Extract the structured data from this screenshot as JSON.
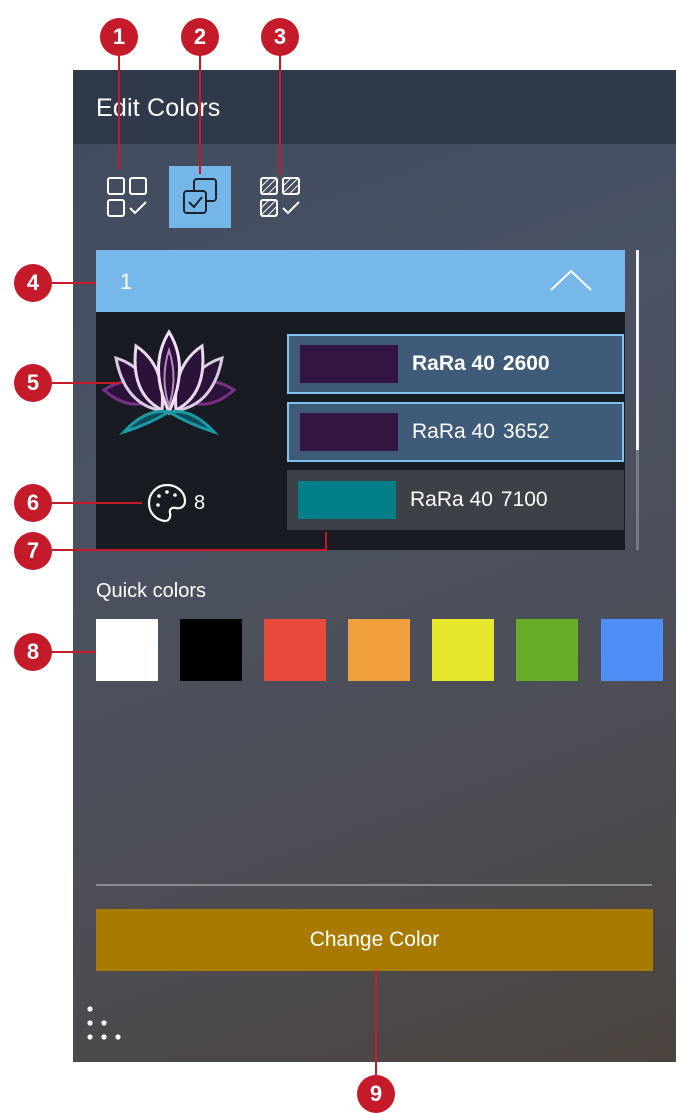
{
  "window": {
    "title": "Edit Colors"
  },
  "modes": [
    {
      "icon": "select-all-icon",
      "active": false
    },
    {
      "icon": "select-similar-icon",
      "active": true
    },
    {
      "icon": "select-stitch-icon",
      "active": false
    }
  ],
  "section": {
    "number": "1",
    "icon": "chevron-up-icon",
    "palette_count": "8"
  },
  "color_rows": [
    {
      "brand": "RaRa 40",
      "code": "2600",
      "swatch": "#321540",
      "selected": true,
      "bold": true
    },
    {
      "brand": "RaRa 40",
      "code": "3652",
      "swatch": "#331640",
      "selected": true,
      "bold": false
    },
    {
      "brand": "RaRa 40",
      "code": "7100",
      "swatch": "#007f86",
      "selected": false,
      "bold": false
    }
  ],
  "quick_colors": {
    "label": "Quick colors",
    "swatches": [
      "#ffffff",
      "#000000",
      "#ea4a3c",
      "#f29f3e",
      "#e6e62c",
      "#68ad27",
      "#4e8ef7"
    ]
  },
  "actions": {
    "change_color": "Change Color"
  },
  "callouts": [
    "1",
    "2",
    "3",
    "4",
    "5",
    "6",
    "7",
    "8",
    "9"
  ],
  "colors": {
    "accent": "#76b8e9",
    "button": "#a87a00",
    "callout": "#c41a2a",
    "titlebar": "#2f394a"
  }
}
